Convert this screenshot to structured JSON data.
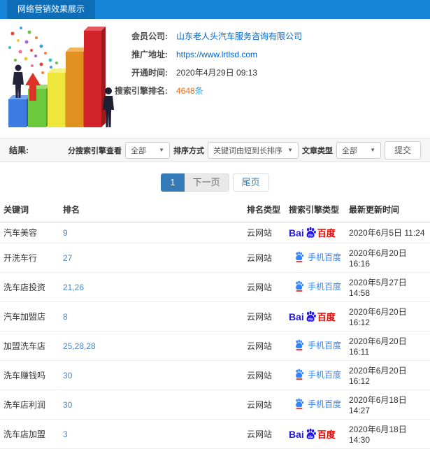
{
  "header": {
    "title": "网络营销效果展示"
  },
  "info": {
    "fields": [
      {
        "label": "会员公司:",
        "value": "山东老人头汽车服务咨询有限公司"
      },
      {
        "label": "推广地址:",
        "value": "https://www.lrtlsd.com"
      },
      {
        "label": "开通时间:",
        "value": "2020年4月29日 09:13"
      },
      {
        "label": "搜索引擎排名:",
        "value": "4648",
        "suffix": "条"
      }
    ]
  },
  "filters": {
    "result_label": "结果:",
    "engine_label": "分搜索引擎查看",
    "engine_value": "全部",
    "sort_label": "排序方式",
    "sort_value": "关键词由短到长排序",
    "article_label": "文章类型",
    "article_value": "全部",
    "submit_label": "提交"
  },
  "pagination": {
    "current": "1",
    "next": "下一页",
    "last": "尾页"
  },
  "table": {
    "headers": [
      "关键词",
      "排名",
      "排名类型",
      "搜索引擎类型",
      "最新更新时间"
    ],
    "rows": [
      {
        "keyword": "汽车美容",
        "rank": "9",
        "rank_type": "云网站",
        "engine": "baidu",
        "updated": "2020年6月5日 11:24"
      },
      {
        "keyword": "开洗车行",
        "rank": "27",
        "rank_type": "云网站",
        "engine": "mobile-baidu",
        "updated": "2020年6月20日 16:16"
      },
      {
        "keyword": "洗车店投资",
        "rank": "21,26",
        "rank_type": "云网站",
        "engine": "mobile-baidu",
        "updated": "2020年5月27日 14:58"
      },
      {
        "keyword": "汽车加盟店",
        "rank": "8",
        "rank_type": "云网站",
        "engine": "baidu",
        "updated": "2020年6月20日 16:12"
      },
      {
        "keyword": "加盟洗车店",
        "rank": "25,28,28",
        "rank_type": "云网站",
        "engine": "mobile-baidu",
        "updated": "2020年6月20日 16:11"
      },
      {
        "keyword": "洗车赚钱吗",
        "rank": "30",
        "rank_type": "云网站",
        "engine": "mobile-baidu",
        "updated": "2020年6月20日 16:12"
      },
      {
        "keyword": "洗车店利润",
        "rank": "30",
        "rank_type": "云网站",
        "engine": "mobile-baidu",
        "updated": "2020年6月18日 14:27"
      },
      {
        "keyword": "洗车店加盟",
        "rank": "3",
        "rank_type": "云网站",
        "engine": "baidu",
        "updated": "2020年6月18日 14:30"
      }
    ]
  },
  "engine_logos": {
    "baidu": {
      "bai": "Bai",
      "du": "du",
      "cn": "百度"
    },
    "mobile_baidu": {
      "label": "手机百度"
    }
  },
  "colors": {
    "header_blue": "#1684d7",
    "header_tab_blue": "#0d6db6",
    "link_blue": "#0066cc",
    "count_orange": "#ff6600",
    "count_unit_blue": "#2aa8e0",
    "rank_link_blue": "#4a86c8",
    "baidu_blue": "#2319dc",
    "baidu_red": "#e10602",
    "mobile_baidu_blue": "#3385ff",
    "pagination_active_blue": "#337ab7"
  }
}
